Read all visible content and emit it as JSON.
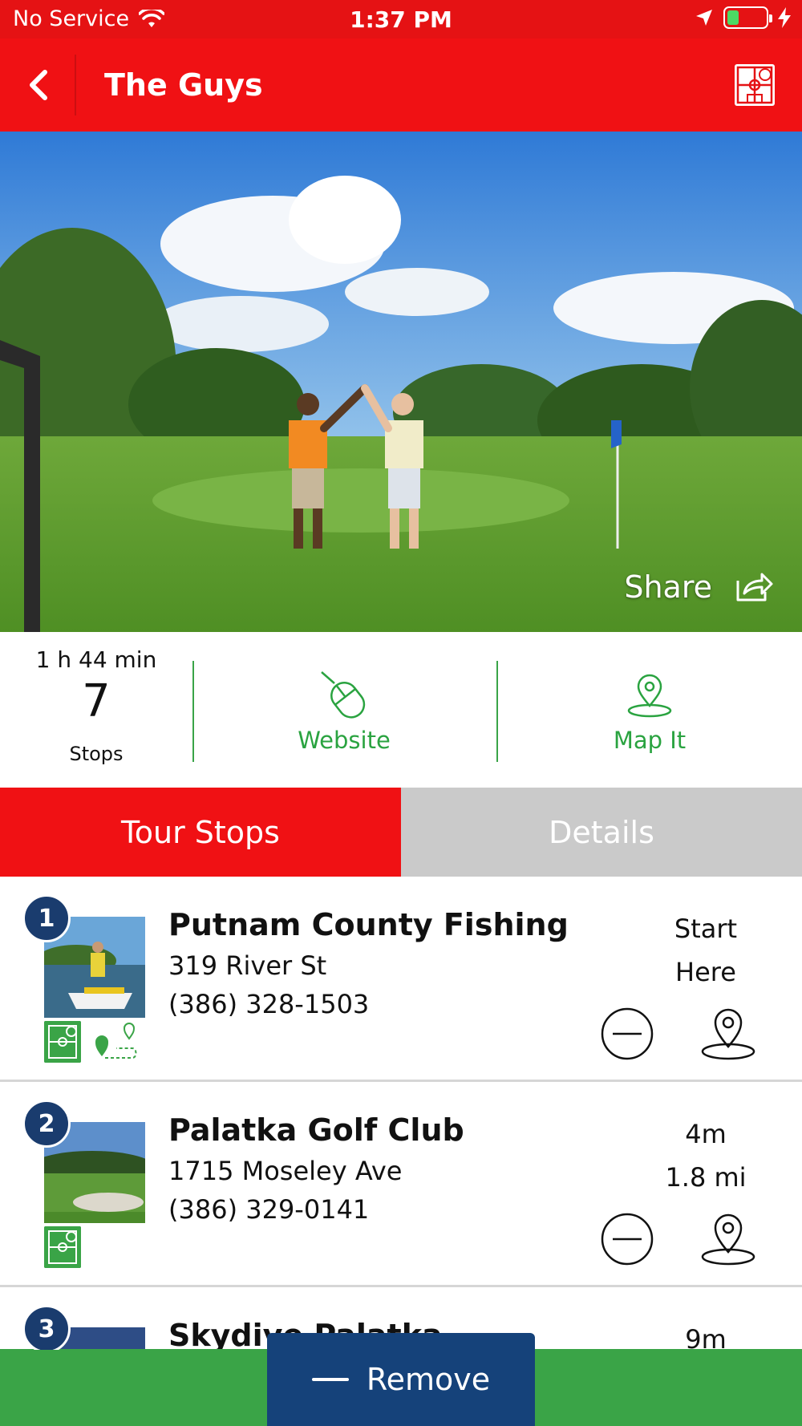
{
  "status_bar": {
    "carrier": "No Service",
    "time": "1:37 PM",
    "battery_level": 0.3
  },
  "header": {
    "title": "The Guys",
    "back_icon": "chevron-left-icon",
    "logo_icon": "app-logo-icon"
  },
  "hero": {
    "share_label": "Share"
  },
  "stats": {
    "duration": "1 h 44 min",
    "stops_count": "7",
    "stops_label": "Stops",
    "website_label": "Website",
    "map_label": "Map It"
  },
  "tabs": [
    {
      "label": "Tour Stops",
      "active": true
    },
    {
      "label": "Details",
      "active": false
    }
  ],
  "stops": [
    {
      "number": "1",
      "name": "Putnam County Fishing",
      "address": "319 River St",
      "phone": "(386) 328-1503",
      "time_line1": "Start",
      "time_line2": "Here",
      "icons": [
        "category-icon",
        "route-icon"
      ]
    },
    {
      "number": "2",
      "name": "Palatka Golf Club",
      "address": "1715 Moseley Ave",
      "phone": "(386) 329-0141",
      "time_line1": "4m",
      "time_line2": "1.8 mi",
      "icons": [
        "category-icon"
      ]
    },
    {
      "number": "3",
      "name": "Skydive Palatka",
      "address": "",
      "phone": "",
      "time_line1": "9m",
      "time_line2": "",
      "icons": []
    }
  ],
  "bottom": {
    "remove_label": "Remove"
  },
  "colors": {
    "brand_red": "#f01114",
    "accent_green": "#3aa447",
    "navy": "#15427a"
  }
}
